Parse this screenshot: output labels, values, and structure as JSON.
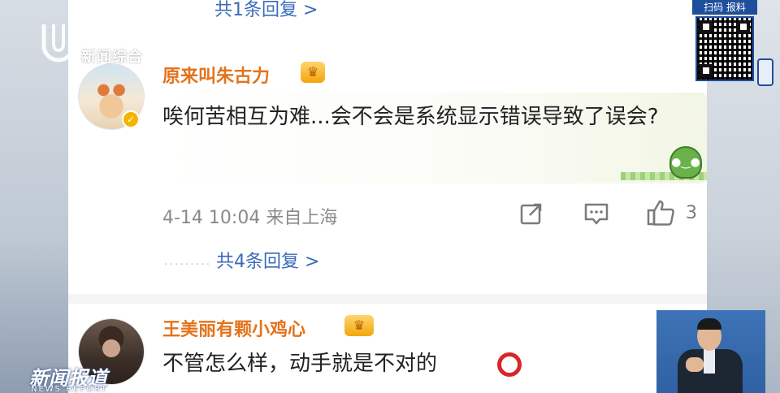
{
  "channel": {
    "name": "新闻综合",
    "qr_label": "扫码 报料",
    "program_title": "新闻报道",
    "program_subtitle": "NEWS REPORT"
  },
  "top_reply_link": "共1条回复 >",
  "comments": [
    {
      "username": "原来叫朱古力",
      "badge_icon": "crown-icon",
      "verified": true,
      "text": "唉何苦相互为难...会不会是系统显示错误导致了误会?",
      "time_location": "4-14 10:04 来自上海",
      "like_count": "3",
      "replies_link": "共4条回复 >",
      "sticker_icon": "green-dinosaur-sticker"
    },
    {
      "username": "王美丽有颗小鸡心",
      "badge_icon": "crown-icon",
      "text": "不管怎么样，动手就是不对的",
      "emoji": "red-circle-emoji"
    }
  ],
  "colors": {
    "username": "#e3731c",
    "link": "#3b6bb7",
    "meta": "#8a8a8a",
    "badge": "#f6b400",
    "emoji_circle": "#d8262b",
    "broadcast_blue": "#1f4e9c"
  }
}
